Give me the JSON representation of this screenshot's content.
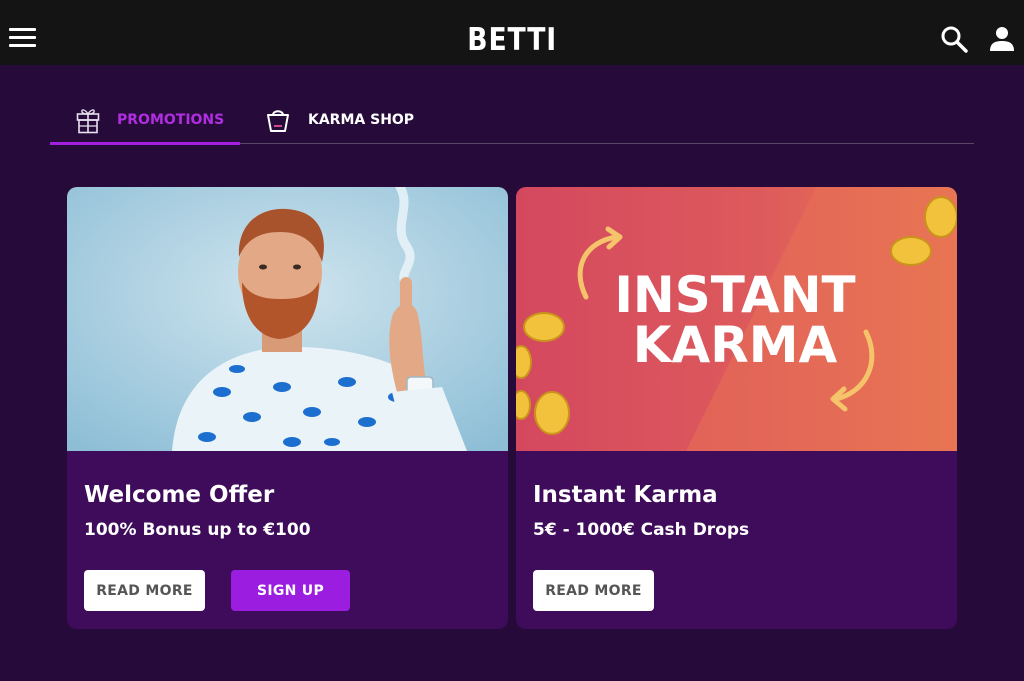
{
  "header": {
    "logo": "BETTI",
    "icons": [
      "hamburger-menu-icon",
      "search-icon",
      "user-icon"
    ]
  },
  "tabs": [
    {
      "label": "PROMOTIONS",
      "icon": "gift-icon",
      "active": true
    },
    {
      "label": "KARMA SHOP",
      "icon": "shopping-bag-icon",
      "active": false
    }
  ],
  "cards": [
    {
      "title": "Welcome Offer",
      "subtitle": "100% Bonus up to €100",
      "buttons": {
        "read_more": "READ MORE",
        "sign_up": "SIGN UP"
      }
    },
    {
      "title": "Instant Karma",
      "subtitle": "5€ - 1000€ Cash Drops",
      "image_text": [
        "INSTANT",
        "KARMA"
      ],
      "buttons": {
        "read_more": "READ MORE"
      }
    }
  ],
  "colors": {
    "background": "#260b3a",
    "topbar": "#141414",
    "card": "#3e0c5a",
    "accent": "#9b1ee0",
    "active_tab": "#b02ee0"
  }
}
